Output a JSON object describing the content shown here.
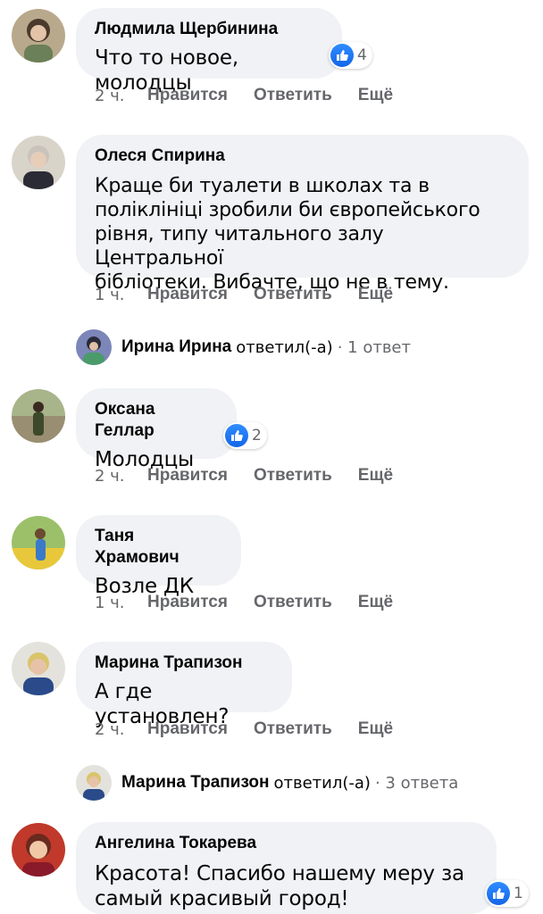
{
  "comments": [
    {
      "author": "Людмила Щербинина",
      "text": "Что то новое, молодцы",
      "likes": "4",
      "time": "2 ч.",
      "like": "Нравится",
      "reply": "Ответить",
      "more": "Ещё"
    },
    {
      "author": "Олеся Спирина",
      "text_lines": [
        "Краще би туалети в школах та в",
        "поліклініці зробили би європейського",
        "рівня, типу читального залу Центральної",
        "бібліотеки. Вибачте, що не в тему."
      ],
      "time": "1 ч.",
      "like": "Нравится",
      "reply": "Ответить",
      "more": "Ещё"
    },
    {
      "author": "Оксана Геллар",
      "text": "Молодцы",
      "likes": "2",
      "time": "2 ч.",
      "like": "Нравится",
      "reply": "Ответить",
      "more": "Ещё"
    },
    {
      "author": "Таня Храмович",
      "text": "Возле ДК",
      "time": "1 ч.",
      "like": "Нравится",
      "reply": "Ответить",
      "more": "Ещё"
    },
    {
      "author": "Марина Трапизон",
      "text": "А где установлен?",
      "time": "2 ч.",
      "like": "Нравится",
      "reply": "Ответить",
      "more": "Ещё"
    },
    {
      "author": "Ангелина Токарева",
      "text_lines": [
        "Красота! Спасибо нашему меру за",
        "самый красивый город!"
      ],
      "likes": "1"
    }
  ],
  "replies": [
    {
      "name": "Ирина Ирина",
      "verb": "ответил(-а)",
      "count": "· 1 ответ"
    },
    {
      "name": "Марина Трапизон",
      "verb": "ответил(-а)",
      "count": "· 3 ответа"
    }
  ],
  "colors": {
    "bubble": "#f0f2f5",
    "text": "#050505",
    "meta": "#65676b",
    "like_blue": "#1877f2"
  },
  "icons": {
    "like": "thumbs-up-icon"
  }
}
